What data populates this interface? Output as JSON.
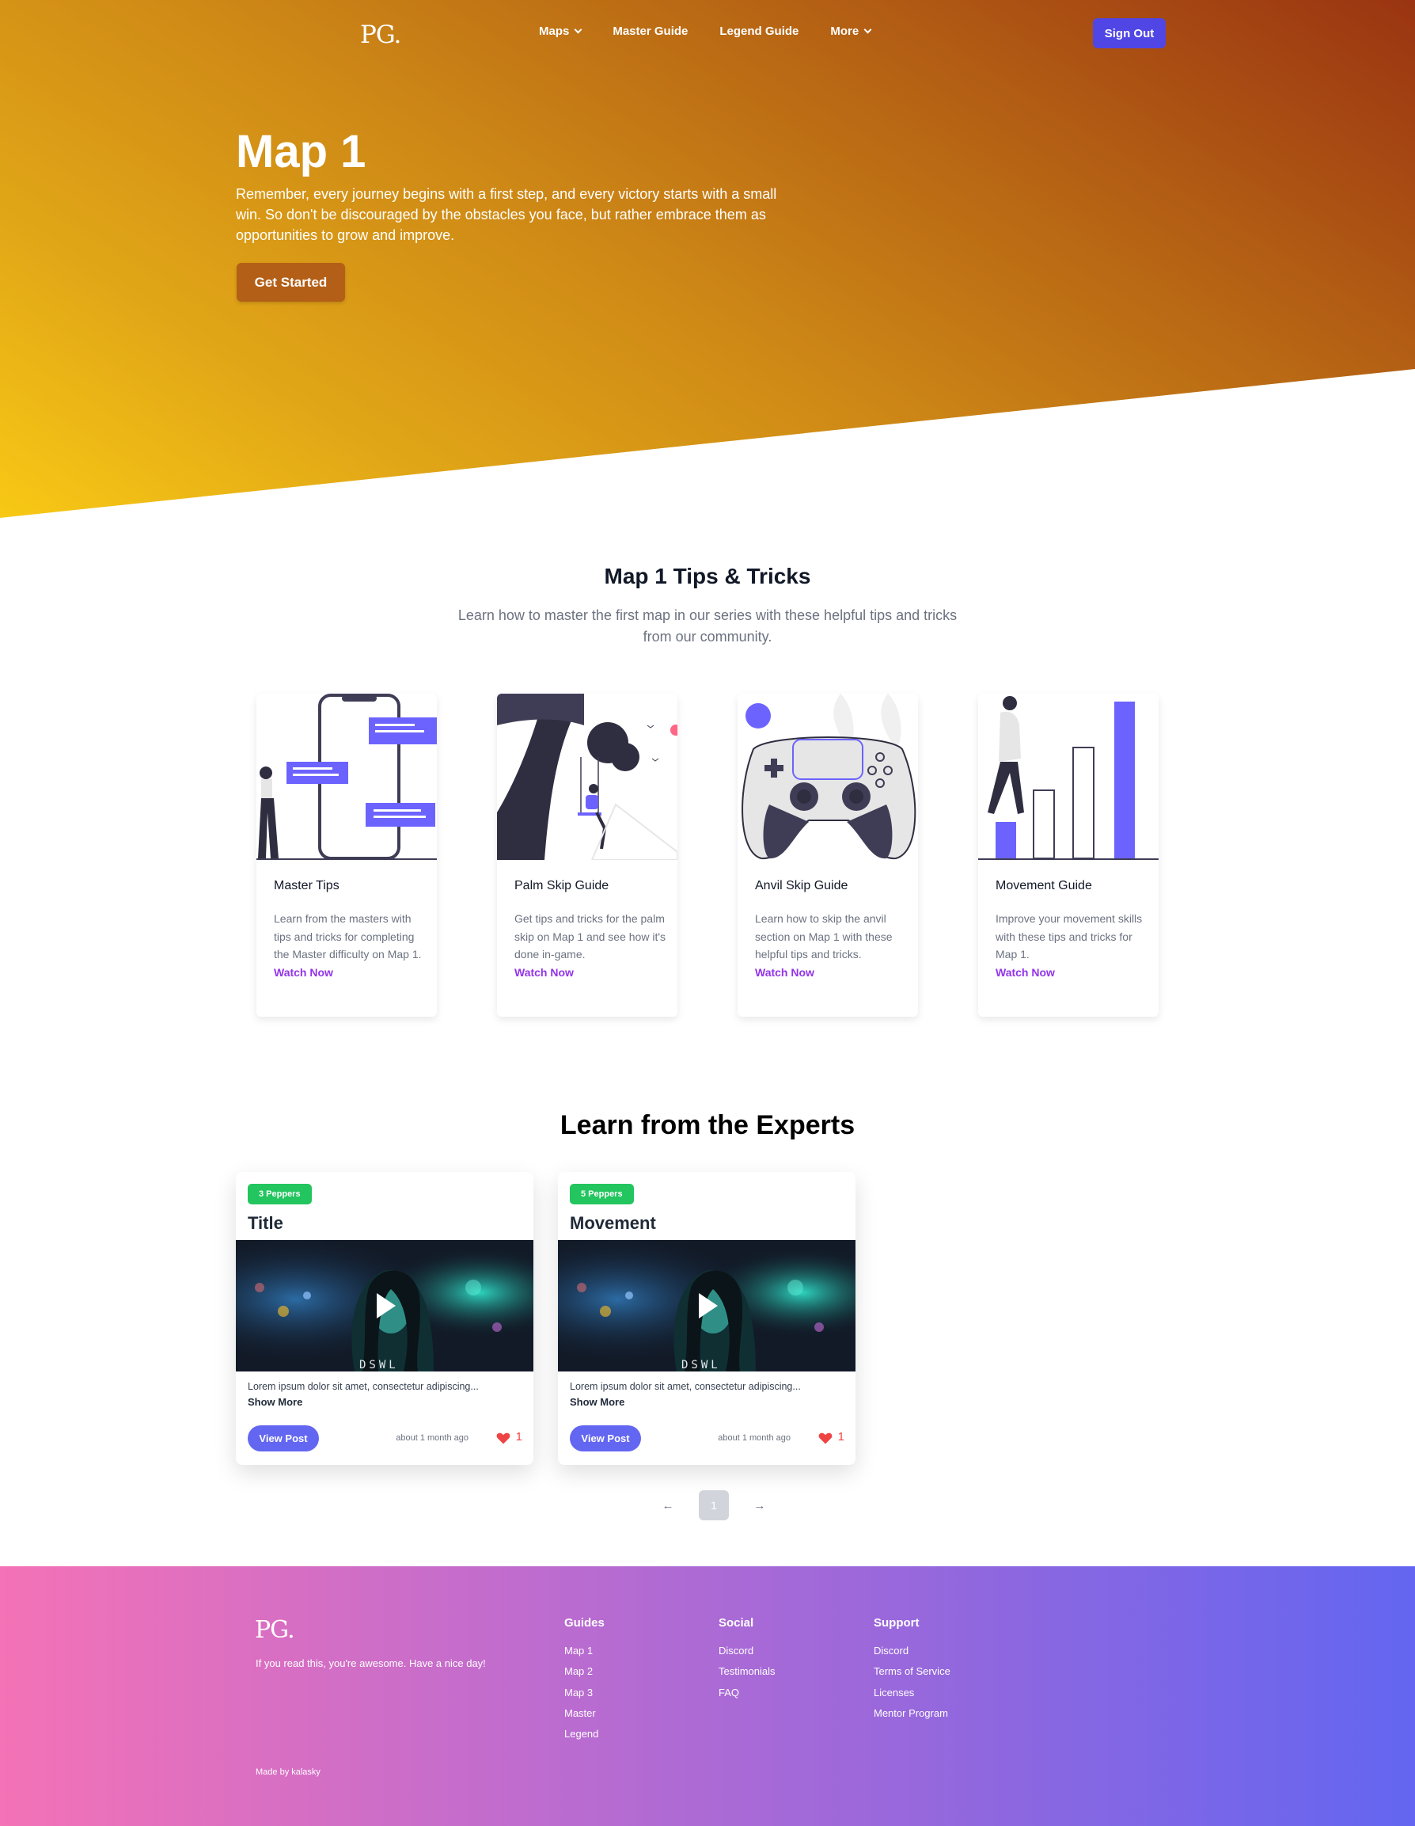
{
  "nav": {
    "logo": "PG.",
    "items": [
      {
        "label": "Maps",
        "dropdown": true
      },
      {
        "label": "Master Guide",
        "dropdown": false
      },
      {
        "label": "Legend Guide",
        "dropdown": false
      },
      {
        "label": "More",
        "dropdown": true
      }
    ],
    "sign_out": "Sign Out"
  },
  "hero": {
    "title": "Map 1",
    "text": "Remember, every journey begins with a first step, and every victory starts with a small win. So don't be discouraged by the obstacles you face, but rather embrace them as opportunities to grow and improve.",
    "cta": "Get Started"
  },
  "tips": {
    "title": "Map 1 Tips & Tricks",
    "subtitle": "Learn how to master the first map in our series with these helpful tips and tricks from our community.",
    "cards": [
      {
        "title": "Master Tips",
        "desc": "Learn from the masters with tips and tricks for completing the Master difficulty on Map 1.",
        "link": "Watch Now",
        "image": "phone-chat-illustration"
      },
      {
        "title": "Palm Skip Guide",
        "desc": "Get tips and tricks for the palm skip on Map 1 and see how it's done in-game.",
        "link": "Watch Now",
        "image": "tree-swing-illustration"
      },
      {
        "title": "Anvil Skip Guide",
        "desc": "Learn how to skip the anvil section on Map 1 with these helpful tips and tricks.",
        "link": "Watch Now",
        "image": "game-controller-illustration"
      },
      {
        "title": "Movement Guide",
        "desc": "Improve your movement skills with these tips and tricks for Map 1.",
        "link": "Watch Now",
        "image": "bar-steps-illustration"
      }
    ]
  },
  "experts": {
    "title": "Learn from the Experts",
    "posts": [
      {
        "badge": "3 Peppers",
        "title": "Title",
        "desc": "Lorem ipsum dolor sit amet, consectetur adipiscing...",
        "show_more": "Show More",
        "button": "View Post",
        "time": "about 1 month ago",
        "likes": "1",
        "thumb_caption": "DSWL"
      },
      {
        "badge": "5 Peppers",
        "title": "Movement",
        "desc": "Lorem ipsum dolor sit amet, consectetur adipiscing...",
        "show_more": "Show More",
        "button": "View Post",
        "time": "about 1 month ago",
        "likes": "1",
        "thumb_caption": "DSWL"
      }
    ]
  },
  "pagination": {
    "prev": "←",
    "page": "1",
    "next": "→"
  },
  "footer": {
    "logo": "PG.",
    "tagline": "If you read this, you're awesome. Have a nice day!",
    "columns": [
      {
        "heading": "Guides",
        "links": [
          "Map 1",
          "Map 2",
          "Map 3",
          "Master",
          "Legend"
        ]
      },
      {
        "heading": "Social",
        "links": [
          "Discord",
          "Testimonials",
          "FAQ"
        ]
      },
      {
        "heading": "Support",
        "links": [
          "Discord",
          "Terms of Service",
          "Licenses",
          "Mentor Program"
        ]
      }
    ],
    "made_by": "Made by kalasky"
  },
  "colors": {
    "accent": "#4f46e5",
    "link": "#9333ea",
    "badge": "#22c55e",
    "heart": "#ef4444"
  }
}
